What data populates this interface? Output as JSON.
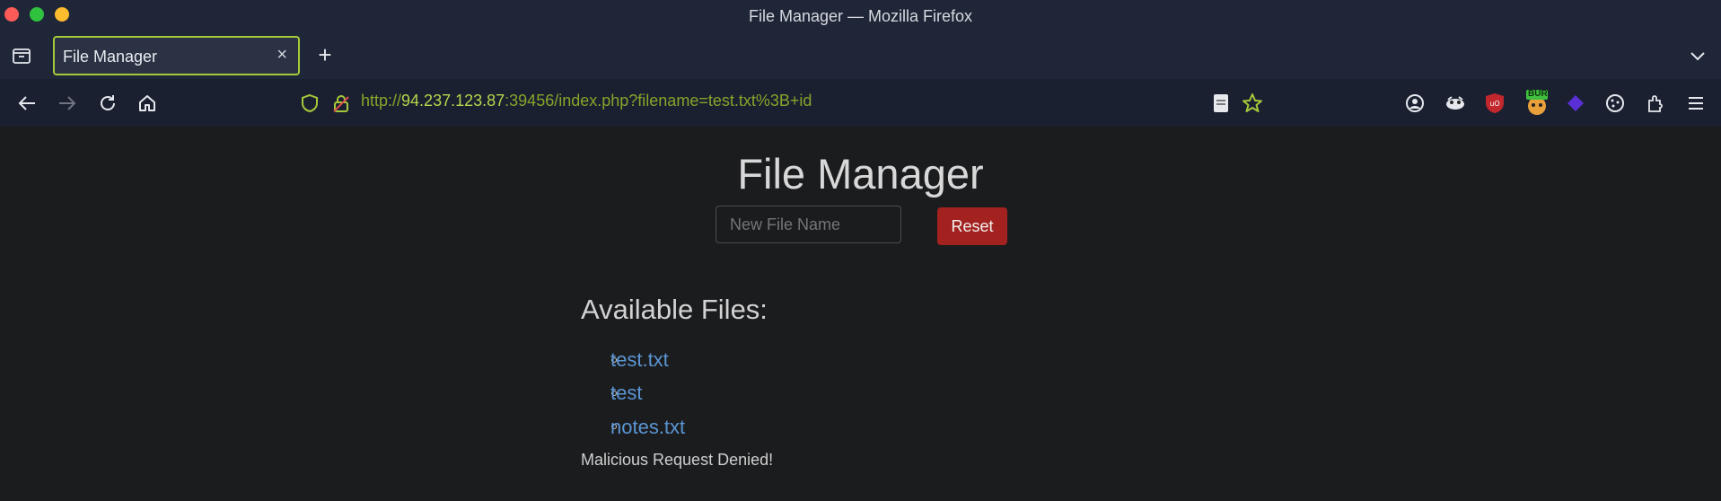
{
  "window": {
    "title": "File Manager — Mozilla Firefox"
  },
  "tab": {
    "title": "File Manager",
    "close": "×",
    "new_tab": "+"
  },
  "url": {
    "scheme": "http://",
    "host": "94.237.123.87",
    "rest": ":39456/index.php?filename=test.txt%3B+id"
  },
  "page": {
    "heading": "File Manager",
    "input_placeholder": "New File Name",
    "reset_label": "Reset",
    "files_heading": "Available Files:",
    "files": [
      "test.txt",
      "test",
      "notes.txt"
    ],
    "message": "Malicious Request Denied!"
  },
  "colors": {
    "accent": "#a5c93a",
    "button": "#a3221f",
    "link": "#5b95d4"
  },
  "extensions": {
    "burp_badge": "BUR"
  },
  "icons": [
    "close-window-icon",
    "minimize-icon",
    "maximize-icon",
    "tab-manager-icon",
    "chevron-down-icon",
    "back-icon",
    "forward-icon",
    "reload-icon",
    "home-icon",
    "shield-icon",
    "insecure-lock-icon",
    "page-icon",
    "bookmark-star-icon",
    "account-icon",
    "extension-icon",
    "ublock-icon",
    "burp-icon",
    "extension-diamond-icon",
    "cookie-icon",
    "extensions-icon",
    "menu-icon"
  ]
}
